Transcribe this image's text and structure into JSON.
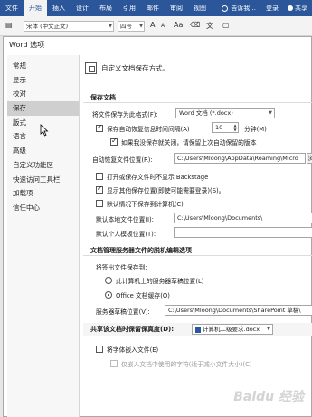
{
  "ribbon": {
    "tabs": [
      "文件",
      "开始",
      "插入",
      "设计",
      "布局",
      "引用",
      "邮件",
      "审阅",
      "视图"
    ],
    "tell_me": "告诉我...",
    "login": "登录",
    "share": "共享"
  },
  "fontbar": {
    "font_name": "宋体 (中文正文)",
    "font_size": "四号",
    "grow": "A",
    "shrink": "A",
    "aa": "Aa"
  },
  "dialog": {
    "title": "Word 选项",
    "nav": [
      "常规",
      "显示",
      "校对",
      "保存",
      "版式",
      "语言",
      "高级",
      "自定义功能区",
      "快速访问工具栏",
      "加载项",
      "信任中心"
    ],
    "active_nav": "保存",
    "header": "自定义文档保存方式。",
    "save_section": {
      "title": "保存文档",
      "format_label": "将文件保存为此格式(F):",
      "format_value": "Word 文档 (*.docx)",
      "autorecover_label": "保存自动恢复信息时间间隔(A)",
      "autorecover_minutes": "10",
      "minutes_unit": "分钟(M)",
      "keep_last_label": "如果我没保存就关闭，请保留上次自动保留的版本",
      "autorecover_path_label": "自动恢复文件位置(R):",
      "autorecover_path": "C:\\Users\\Mloong\\AppData\\Roaming\\Micro",
      "browse_label": "浏",
      "backstage_label": "打开或保存文件时不显示 Backstage",
      "other_locations_label": "显示其他保存位置(即使可能需要登录)(S)。",
      "default_computer_label": "默认情况下保存到计算机(C)",
      "local_path_label": "默认本地文件位置(I):",
      "local_path": "C:\\Users\\Mloong\\Documents\\",
      "template_label": "默认个人模板位置(T):",
      "template_path": ""
    },
    "offline_section": {
      "title": "文档管理服务器文件的脱机编辑选项",
      "checkout_label": "将签出文件保存到:",
      "option_server": "此计算机上的服务器草稿位置(L)",
      "option_office": "Office 文档缓存(O)",
      "drafts_label": "服务器草稿位置(V):",
      "drafts_path": "C:\\Users\\Mloong\\Documents\\SharePoint 草稿\\"
    },
    "fidelity": {
      "label": "共享该文档时保留保真度(D):",
      "doc_name": "计算机二级要求.docx",
      "embed_fonts_label": "将字体嵌入文件(E)",
      "embed_used_label": "仅嵌入文档中使用的字符(适于减小文件大小)(C)"
    },
    "watermark": "Baidu 经验"
  }
}
